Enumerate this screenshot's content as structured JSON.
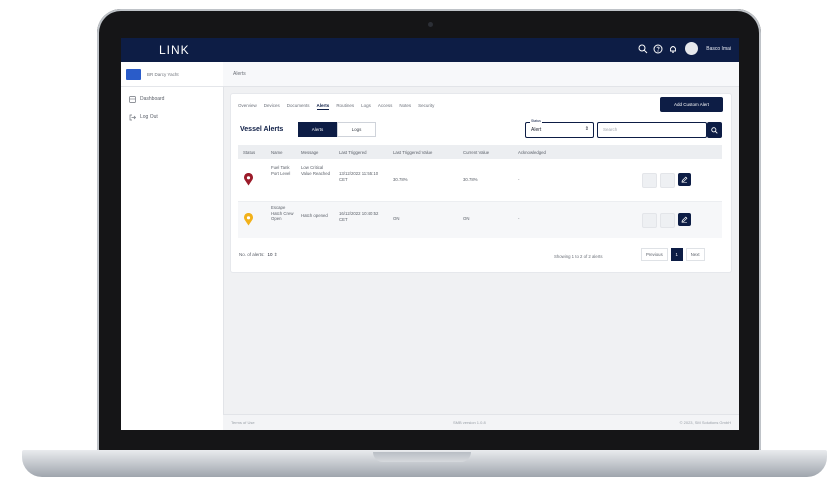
{
  "app": {
    "brand": "LINK",
    "user_name": "Basco Imai"
  },
  "sidebar": {
    "account_name": "BR Darcy Yacht",
    "items": [
      {
        "label": "Dashboard"
      },
      {
        "label": "Log Out"
      }
    ]
  },
  "breadcrumb": "Alerts",
  "tabs": [
    "Overview",
    "Devices",
    "Documents",
    "Alerts",
    "Routines",
    "Logs",
    "Access",
    "Notes",
    "Security"
  ],
  "active_tab": "Alerts",
  "add_button": "Add Custom Alert",
  "section_title": "Vessel Alerts",
  "toggle": {
    "alerts": "Alerts",
    "logs": "Logs"
  },
  "filter": {
    "label": "Status",
    "value": "Alert",
    "search_placeholder": "Search"
  },
  "table": {
    "headers": [
      "Status",
      "Name",
      "Message",
      "Last Triggered",
      "Last Triggered Value",
      "Current Value",
      "Acknowledged"
    ],
    "rows": [
      {
        "status_color": "#9b1b2a",
        "name": "Fuel Tank Port Level",
        "message": "Low Critical Value Reached",
        "last_triggered": "13/12/2022 11:55:10 CET",
        "last_value": "30.78%",
        "current_value": "30.78%",
        "acknowledged": "-"
      },
      {
        "status_color": "#f2b11a",
        "name": "Escape Hatch Crew Open",
        "message": "Hatch opened",
        "last_triggered": "16/12/2022 10:40:52 CET",
        "last_value": "ON",
        "current_value": "ON",
        "acknowledged": "-"
      }
    ]
  },
  "pagination": {
    "per_page_label": "No. of alerts:",
    "per_page_value": "10",
    "showing": "Showing 1 to 2 of 2 alerts",
    "previous": "Previous",
    "page": "1",
    "next": "Next"
  },
  "footer": {
    "left": "Terms of Use",
    "center": "SMB version 1.0.8",
    "right": "© 2023, SM Solutions GmbH"
  },
  "colors": {
    "navy": "#0d1d45",
    "critical": "#9b1b2a",
    "warning": "#f2b11a"
  }
}
